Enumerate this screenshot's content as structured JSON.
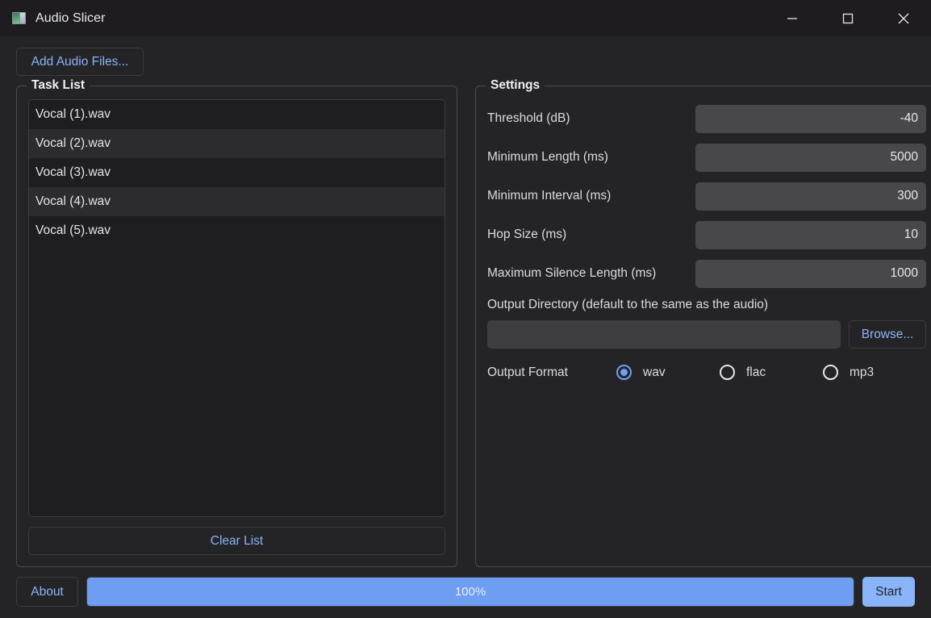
{
  "window": {
    "title": "Audio Slicer",
    "icon": "app-window-icon",
    "controls": {
      "minimize": "minimize-icon",
      "maximize": "maximize-icon",
      "close": "close-icon"
    }
  },
  "toolbar": {
    "add_audio_label": "Add Audio Files..."
  },
  "task_list": {
    "title": "Task List",
    "items": [
      {
        "name": "Vocal (1).wav"
      },
      {
        "name": "Vocal (2).wav"
      },
      {
        "name": "Vocal (3).wav"
      },
      {
        "name": "Vocal (4).wav"
      },
      {
        "name": "Vocal (5).wav"
      }
    ],
    "clear_label": "Clear List"
  },
  "settings": {
    "title": "Settings",
    "fields": [
      {
        "label": "Threshold (dB)",
        "value": "-40"
      },
      {
        "label": "Minimum Length (ms)",
        "value": "5000"
      },
      {
        "label": "Minimum Interval (ms)",
        "value": "300"
      },
      {
        "label": "Hop Size (ms)",
        "value": "10"
      },
      {
        "label": "Maximum Silence Length (ms)",
        "value": "1000"
      }
    ],
    "output_directory": {
      "label": "Output Directory (default to the same as the audio)",
      "value": "",
      "placeholder": "",
      "browse_label": "Browse..."
    },
    "output_format": {
      "label": "Output Format",
      "selected": "wav",
      "options": [
        {
          "label": "wav",
          "checked": true
        },
        {
          "label": "flac",
          "checked": false
        },
        {
          "label": "mp3",
          "checked": false
        }
      ]
    }
  },
  "bottom": {
    "about_label": "About",
    "progress_text": "100%",
    "progress_percent": 100,
    "start_label": "Start"
  },
  "colors": {
    "accent_blue": "#6d9ef2",
    "link_blue": "#8ab4f8",
    "window_bg": "#242427",
    "titlebar_bg": "#1e1c21",
    "field_bg": "#48484c"
  }
}
